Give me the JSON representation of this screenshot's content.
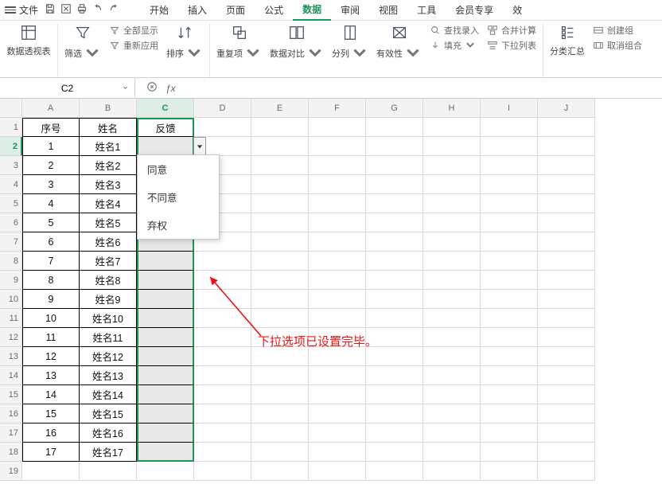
{
  "menu": {
    "file": "文件",
    "tabs": [
      "开始",
      "插入",
      "页面",
      "公式",
      "数据",
      "审阅",
      "视图",
      "工具",
      "会员专享",
      "效"
    ],
    "active_index": 4
  },
  "ribbon": {
    "pivot": "数据透视表",
    "filter": "筛选",
    "show_all": "全部显示",
    "reapply": "重新应用",
    "sort": "排序",
    "duplicate": "重复项",
    "compare": "数据对比",
    "split": "分列",
    "validity": "有效性",
    "fill": "填充",
    "lookup": "查找录入",
    "consolidate": "合并计算",
    "dropdown_list": "下拉列表",
    "subtotal": "分类汇总",
    "ungroup": "取消组合",
    "create_group": "创建组"
  },
  "namebox": {
    "value": "C2"
  },
  "grid": {
    "cols": [
      "A",
      "B",
      "C",
      "D",
      "E",
      "F",
      "G",
      "H",
      "I",
      "J"
    ],
    "headers": {
      "A": "序号",
      "B": "姓名",
      "C": "反馈"
    },
    "rows": [
      {
        "n": "1",
        "name": "姓名1"
      },
      {
        "n": "2",
        "name": "姓名2"
      },
      {
        "n": "3",
        "name": "姓名3"
      },
      {
        "n": "4",
        "name": "姓名4"
      },
      {
        "n": "5",
        "name": "姓名5"
      },
      {
        "n": "6",
        "name": "姓名6"
      },
      {
        "n": "7",
        "name": "姓名7"
      },
      {
        "n": "8",
        "name": "姓名8"
      },
      {
        "n": "9",
        "name": "姓名9"
      },
      {
        "n": "10",
        "name": "姓名10"
      },
      {
        "n": "11",
        "name": "姓名11"
      },
      {
        "n": "12",
        "name": "姓名12"
      },
      {
        "n": "13",
        "name": "姓名13"
      },
      {
        "n": "14",
        "name": "姓名14"
      },
      {
        "n": "15",
        "name": "姓名15"
      },
      {
        "n": "16",
        "name": "姓名16"
      },
      {
        "n": "17",
        "name": "姓名17"
      }
    ],
    "visible_rows": 19
  },
  "dropdown": {
    "options": [
      "同意",
      "不同意",
      "弃权"
    ]
  },
  "annotation": "下拉选项已设置完毕。",
  "colors": {
    "accent": "#1f945a",
    "anno": "#e11d1d"
  }
}
